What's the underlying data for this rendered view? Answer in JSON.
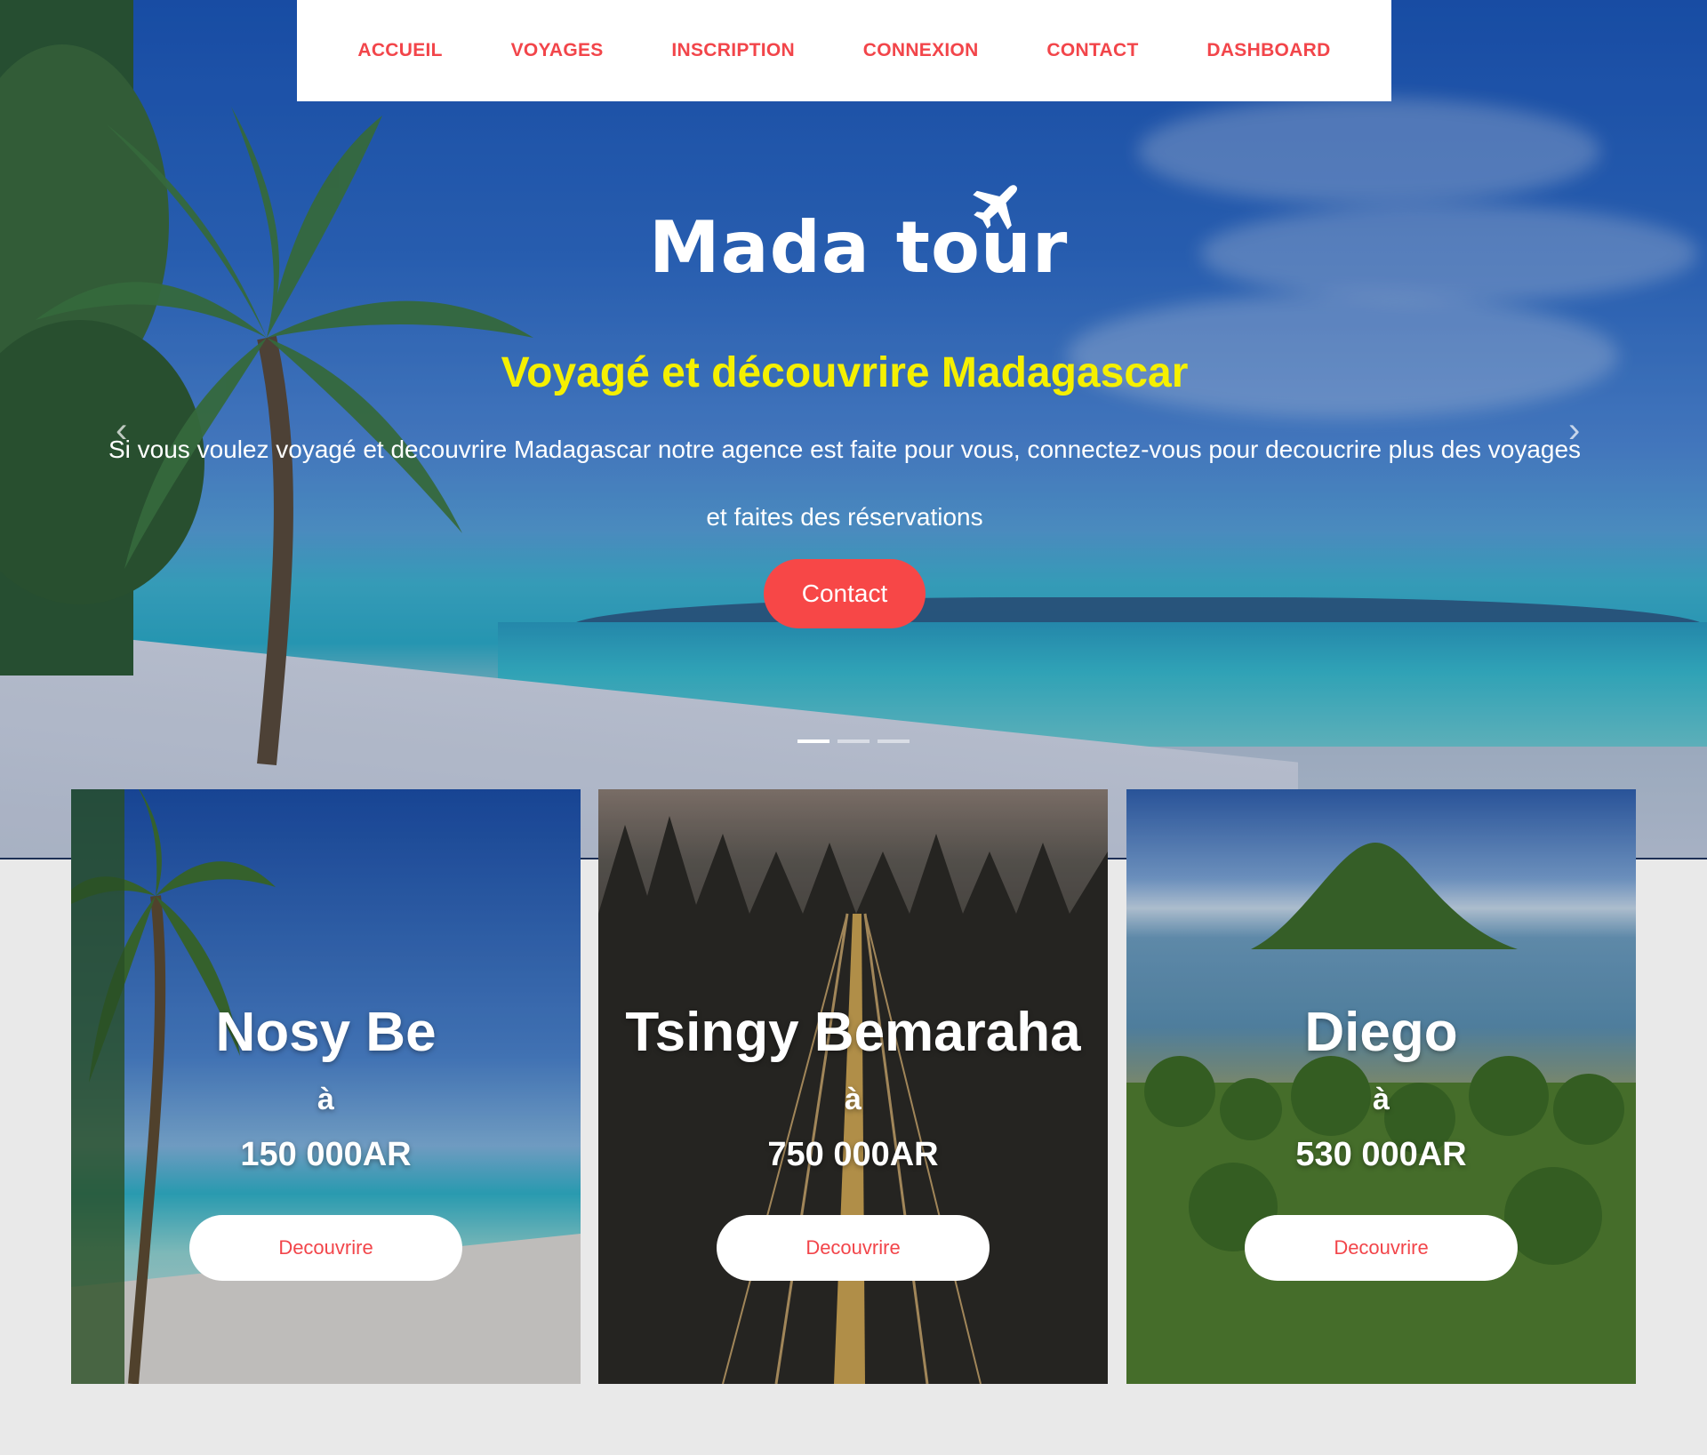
{
  "nav": {
    "items": [
      {
        "label": "ACCUEIL"
      },
      {
        "label": "VOYAGES"
      },
      {
        "label": "INSCRIPTION"
      },
      {
        "label": "CONNEXION"
      },
      {
        "label": "CONTACT"
      },
      {
        "label": "DASHBOARD"
      }
    ]
  },
  "hero": {
    "logo": "Mada tour",
    "title": "Voyagé et découvrire Madagascar",
    "text": "Si vous voulez voyagé et decouvrire Madagascar notre agence est faite pour vous, connectez-vous pour decoucrire plus des voyages et faites des réservations",
    "button": "Contact",
    "slides": 3,
    "active_slide": 1
  },
  "cards": [
    {
      "title": "Nosy Be",
      "prep": "à",
      "price": "150 000AR",
      "button": "Decouvrire"
    },
    {
      "title": "Tsingy Bemaraha",
      "prep": "à",
      "price": "750 000AR",
      "button": "Decouvrire"
    },
    {
      "title": "Diego",
      "prep": "à",
      "price": "530 000AR",
      "button": "Decouvrire"
    }
  ],
  "colors": {
    "accent": "#f74747",
    "nav_text": "#f2454a",
    "hero_title": "#f5f000",
    "page_bg": "#e9e9e9"
  }
}
